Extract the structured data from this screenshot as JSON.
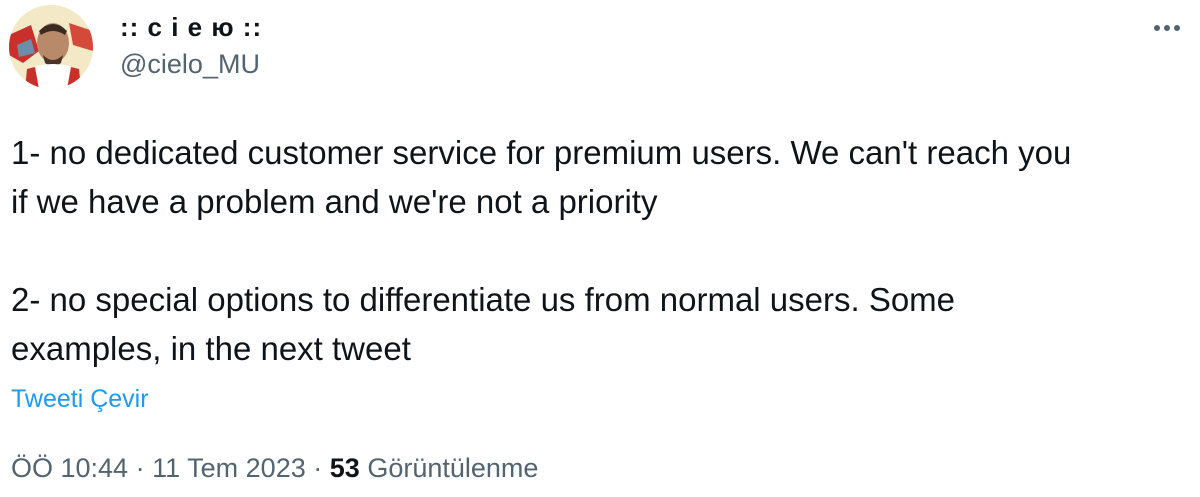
{
  "author": {
    "display_name": ":: c i e ю ::",
    "handle": "@cielo_MU",
    "avatar_icon": "profile-avatar"
  },
  "actions": {
    "more_icon": "more-horizontal-icon"
  },
  "tweet": {
    "text": "1- no dedicated customer service for premium users. We can't reach you\nif we have a problem and we're not a priority\n\n2- no special options to differentiate us from normal users. Some\nexamples, in the next tweet",
    "translate_label": "Tweeti Çevir"
  },
  "meta": {
    "time": "ÖÖ 10:44",
    "separator": "·",
    "date": "11 Tem 2023",
    "views_count": "53",
    "views_label": "Görüntülenme"
  },
  "colors": {
    "text": "#0f1419",
    "secondary": "#536471",
    "link": "#1d9bf0"
  }
}
